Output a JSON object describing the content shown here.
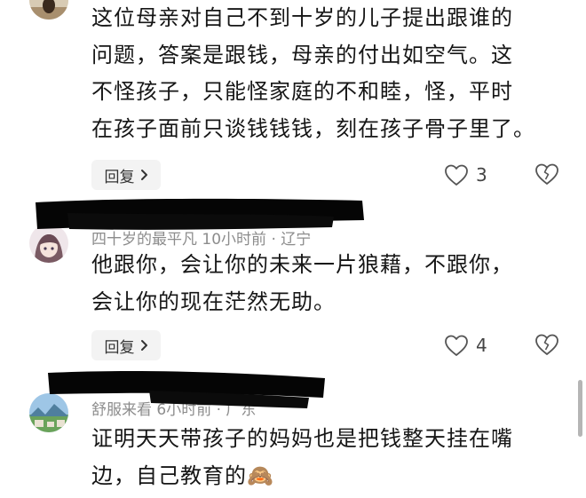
{
  "comments": [
    {
      "lines": [
        "这位母亲对自己不到十岁的儿子提出跟谁的",
        "问题，答案是跟钱，母亲的付出如空气。这",
        "不怪孩子，只能怪家庭的不和睦，怪，平时",
        "在孩子面前只谈钱钱钱，刻在孩子骨子里了。"
      ],
      "reply_label": "回复",
      "likes": "3"
    },
    {
      "meta": "四十岁的最平凡  10小时前 · 辽宁",
      "lines": [
        "他跟你，会让你的未来一片狼藉，不跟你，",
        "会让你的现在茫然无助。"
      ],
      "reply_label": "回复",
      "likes": "4"
    },
    {
      "meta": "舒服来看  6小时前 · 广东",
      "lines": [
        "证明天天带孩子的妈妈也是把钱整天挂在嘴",
        "边，自己教育的🙈"
      ]
    }
  ],
  "icons": {
    "reply_arrow": "chevron-right-icon",
    "like": "heart-outline-icon",
    "dislike": "broken-heart-icon"
  },
  "colors": {
    "redaction": "#050505",
    "reply_bg": "#f3f3f3",
    "meta": "#8c8c8c"
  }
}
